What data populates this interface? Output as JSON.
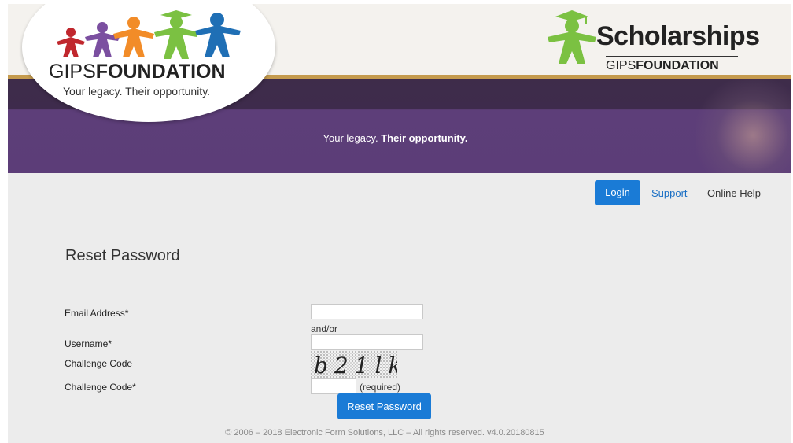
{
  "header": {
    "logo_name_light": "GIPS",
    "logo_name_bold": "FOUNDATION",
    "logo_motto": "Your legacy. Their opportunity.",
    "scholarships_title": "Scholarships",
    "scholarships_sub_light": "GIPS",
    "scholarships_sub_bold": "FOUNDATION",
    "tagline_light": "Your legacy.",
    "tagline_bold": "Their opportunity.",
    "colors": {
      "gold_stripe": "#c59b4e",
      "banner_purple": "#5c3d78",
      "figure_green": "#7bc142"
    }
  },
  "nav": {
    "login": "Login",
    "support": "Support",
    "online_help": "Online Help"
  },
  "form": {
    "title": "Reset Password",
    "email_label": "Email Address*",
    "email_value": "",
    "and_or": "and/or",
    "username_label": "Username*",
    "username_value": "",
    "challenge_image_label": "Challenge Code",
    "challenge_input_label": "Challenge Code*",
    "challenge_value": "",
    "captcha_text": "b21lk",
    "required_note": "(required)",
    "submit": "Reset Password"
  },
  "footer": {
    "text": "© 2006 – 2018 Electronic Form Solutions, LLC  –  All rights reserved.  v4.0.20180815"
  }
}
